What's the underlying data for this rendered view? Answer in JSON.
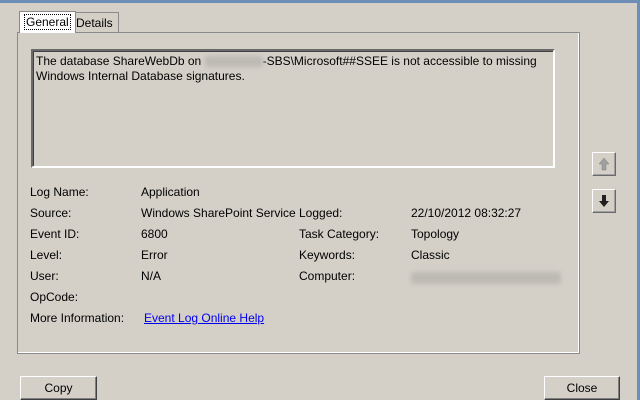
{
  "tabs": [
    {
      "label": "General"
    },
    {
      "label": "Details"
    }
  ],
  "message": {
    "part1": "The database ShareWebDb on",
    "part2": "-SBS\\Microsoft##SSEE is not accessible to missing Windows Internal Database signatures."
  },
  "fields": {
    "log_name_label": "Log Name:",
    "log_name_value": "Application",
    "source_label": "Source:",
    "source_value": "Windows SharePoint Service",
    "logged_label": "Logged:",
    "logged_value": "22/10/2012 08:32:27",
    "event_id_label": "Event ID:",
    "event_id_value": "6800",
    "task_category_label": "Task Category:",
    "task_category_value": "Topology",
    "level_label": "Level:",
    "level_value": "Error",
    "keywords_label": "Keywords:",
    "keywords_value": "Classic",
    "user_label": "User:",
    "user_value": "N/A",
    "computer_label": "Computer:",
    "opcode_label": "OpCode:",
    "more_info_label": "More Information:",
    "more_info_link": "Event Log Online Help"
  },
  "buttons": {
    "copy": "Copy",
    "close": "Close"
  },
  "icons": {
    "scroll_up": "arrow-up-icon",
    "scroll_down": "arrow-down-icon"
  },
  "colors": {
    "background": "#d4d0c8",
    "link": "#0000ee",
    "window_frame": "#6d8fb5"
  }
}
